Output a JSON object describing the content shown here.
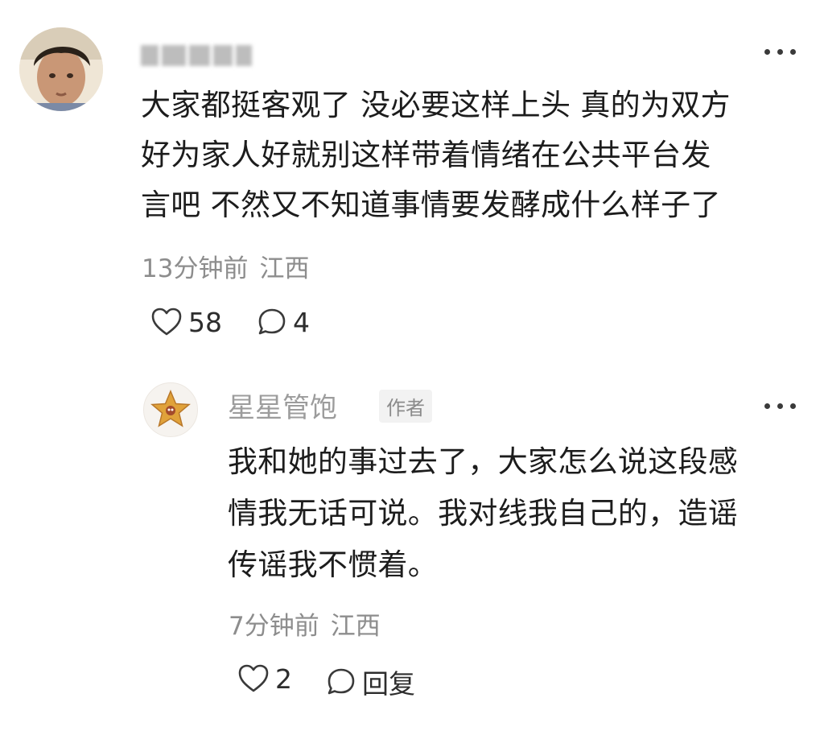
{
  "comment": {
    "username": "",
    "lines": [
      "大家都挺客观了 没必要这样上头 真的为双方",
      "好为家人好就别这样带着情绪在公共平台发",
      "言吧 不然又不知道事情要发酵成什么样子了"
    ],
    "time": "13分钟前",
    "location": "江西",
    "likes": "58",
    "replies": "4"
  },
  "reply": {
    "name": "星星管饱",
    "badge": "作者",
    "lines": [
      "我和她的事过去了，大家怎么说这段感",
      "情我无话可说。我对线我自己的，造谣",
      "传谣我不惯着。"
    ],
    "time": "7分钟前",
    "location": "江西",
    "likes": "2",
    "reply_label": "回复"
  },
  "icons": {
    "more": "more-dots-icon",
    "like": "heart-icon",
    "comment": "comment-bubble-icon"
  },
  "colors": {
    "text": "#1c1c1c",
    "meta": "#8d8d8d",
    "name": "#9c9c9c"
  }
}
